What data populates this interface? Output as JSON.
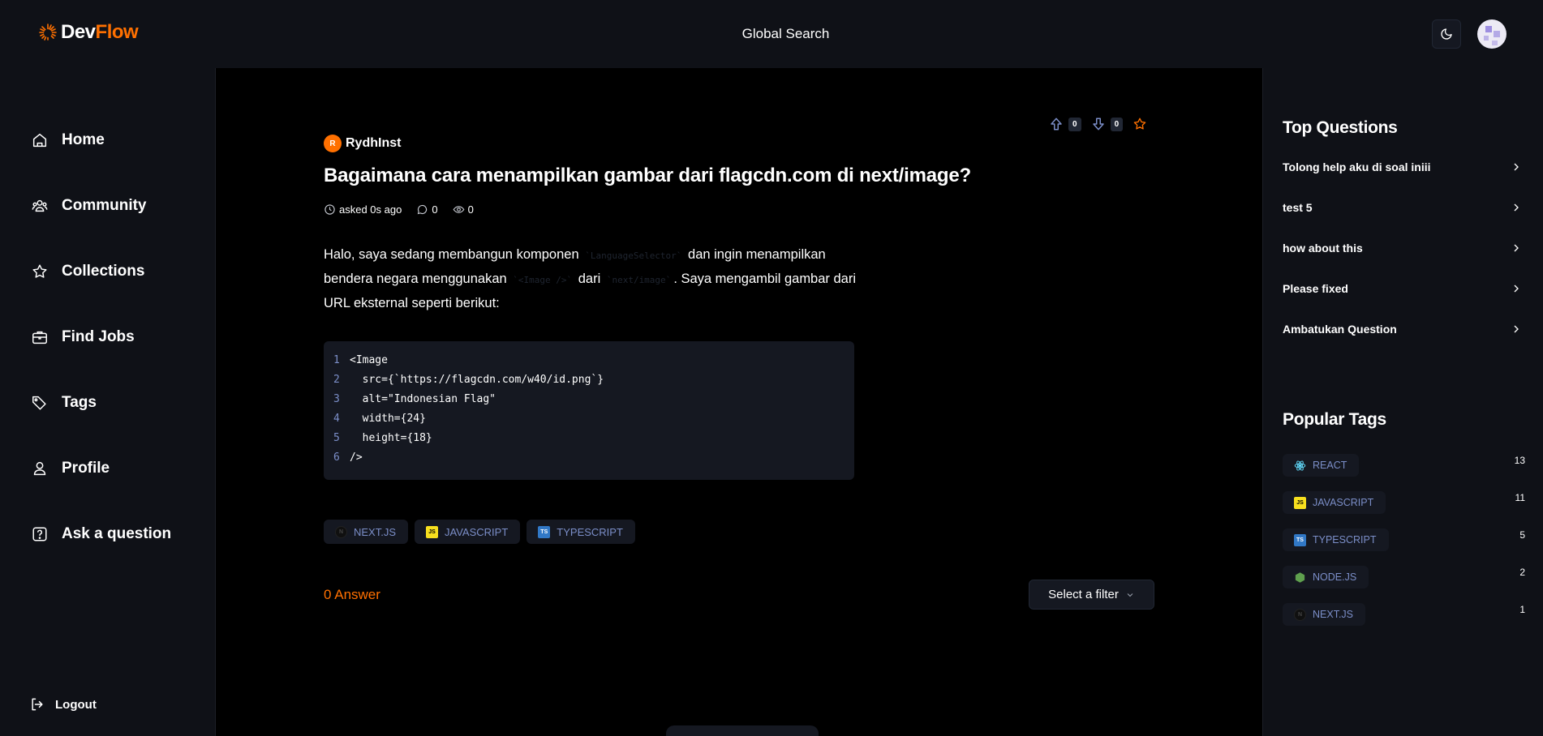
{
  "header": {
    "logo_prefix": "Dev",
    "logo_suffix": "Flow",
    "search_label": "Global Search"
  },
  "sidebar": {
    "items": [
      {
        "label": "Home",
        "icon": "home-icon"
      },
      {
        "label": "Community",
        "icon": "users-icon"
      },
      {
        "label": "Collections",
        "icon": "star-icon"
      },
      {
        "label": "Find Jobs",
        "icon": "briefcase-icon"
      },
      {
        "label": "Tags",
        "icon": "tag-icon"
      },
      {
        "label": "Profile",
        "icon": "user-icon"
      },
      {
        "label": "Ask a question",
        "icon": "question-icon"
      }
    ],
    "logout_label": "Logout"
  },
  "question": {
    "author_initial": "R",
    "author": "RydhInst",
    "upvotes": "0",
    "downvotes": "0",
    "title": "Bagaimana cara menampilkan gambar dari flagcdn.com di next/image?",
    "asked": "asked 0s ago",
    "answers_count": "0",
    "views": "0",
    "body": {
      "p1": "Halo, saya sedang membangun komponen ",
      "c1": "`LanguageSelector`",
      "p2": " dan ingin menampilkan bendera negara menggunakan ",
      "c2": "`<Image />`",
      "p3": " dari ",
      "c3": "`next/image`",
      "p4": ". Saya mengambil gambar dari URL eksternal seperti berikut:"
    },
    "code": [
      {
        "n": "1",
        "t": "<Image"
      },
      {
        "n": "2",
        "t": "  src={`https://flagcdn.com/w40/id.png`}"
      },
      {
        "n": "3",
        "t": "  alt=\"Indonesian Flag\""
      },
      {
        "n": "4",
        "t": "  width={24}"
      },
      {
        "n": "5",
        "t": "  height={18}"
      },
      {
        "n": "6",
        "t": "/>"
      }
    ],
    "tags": [
      "NEXT.JS",
      "JAVASCRIPT",
      "TYPESCRIPT"
    ]
  },
  "answers": {
    "label": "0 Answer",
    "filter_placeholder": "Select a filter"
  },
  "right_sidebar": {
    "top_title": "Top Questions",
    "top_questions": [
      "Tolong help aku di soal iniii",
      "test 5",
      "how about this",
      "Please fixed",
      "Ambatukan Question"
    ],
    "tags_title": "Popular Tags",
    "popular_tags": [
      {
        "name": "REACT",
        "count": "13",
        "icon": "react-icon"
      },
      {
        "name": "JAVASCRIPT",
        "count": "11",
        "icon": "javascript-icon"
      },
      {
        "name": "TYPESCRIPT",
        "count": "5",
        "icon": "typescript-icon"
      },
      {
        "name": "NODE.JS",
        "count": "2",
        "icon": "nodejs-icon"
      },
      {
        "name": "NEXT.JS",
        "count": "1",
        "icon": "nextjs-icon"
      }
    ]
  },
  "colors": {
    "accent": "#ff7000",
    "tag_text": "#7b8ec8",
    "panel": "#0f1117",
    "card": "#151821"
  }
}
